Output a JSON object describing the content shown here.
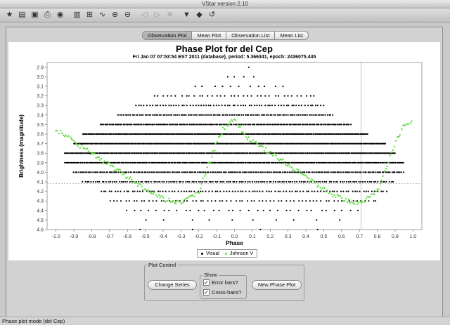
{
  "window": {
    "title": "VStar version 2.10"
  },
  "toolbar": {
    "icons": [
      {
        "name": "new-star-icon",
        "glyph": "★"
      },
      {
        "name": "open-file-icon",
        "glyph": "▤"
      },
      {
        "name": "save-icon",
        "glyph": "▣"
      },
      {
        "name": "print-icon",
        "glyph": "⎙"
      },
      {
        "name": "info-icon",
        "glyph": "◉"
      },
      {
        "name": "properties-icon",
        "glyph": "▥"
      },
      {
        "name": "raw-data-icon",
        "glyph": "⊞"
      },
      {
        "name": "phase-plot-icon",
        "glyph": "∿"
      },
      {
        "name": "zoom-in-icon",
        "glyph": "⊕"
      },
      {
        "name": "zoom-out-icon",
        "glyph": "⊖"
      },
      {
        "name": "pan-left-icon",
        "glyph": "◁"
      },
      {
        "name": "pan-right-icon",
        "glyph": "▷"
      },
      {
        "name": "close-icon",
        "glyph": "✕"
      },
      {
        "name": "filter-icon",
        "glyph": "▼"
      },
      {
        "name": "select-icon",
        "glyph": "◆"
      },
      {
        "name": "undo-icon",
        "glyph": "↺"
      }
    ]
  },
  "tabs": [
    "Observation Plot",
    "Mean Plot",
    "Observation List",
    "Mean List"
  ],
  "active_tab": 0,
  "colors": {
    "visual": "#000000",
    "johnson_v": "#5ddc3c",
    "crosshair": "#999999"
  },
  "chart_data": {
    "type": "scatter",
    "title": "Phase Plot for del Cep",
    "subtitle": "Fri Jan 07 07:53:54 EST 2011 (database), period: 5.366341, epoch: 2436075.445",
    "xlabel": "Phase",
    "ylabel": "Brightness (magnitude)",
    "xlim": [
      -1.05,
      1.05
    ],
    "ylim": [
      4.6,
      2.85
    ],
    "xticks": [
      "-1.0",
      "-0.9",
      "-0.8",
      "-0.7",
      "-0.6",
      "-0.5",
      "-0.4",
      "-0.3",
      "-0.2",
      "-0.1",
      "0.0",
      "0.1",
      "0.2",
      "0.3",
      "0.4",
      "0.5",
      "0.6",
      "0.7",
      "0.8",
      "0.9",
      "1.0"
    ],
    "yticks": [
      "2.9",
      "3.0",
      "3.1",
      "3.2",
      "3.3",
      "3.4",
      "3.5",
      "3.6",
      "3.7",
      "3.8",
      "3.9",
      "4.0",
      "4.1",
      "4.2",
      "4.3",
      "4.4",
      "4.5",
      "4.6"
    ],
    "crosshair": {
      "x": 0.71,
      "y": 4.12
    },
    "series": [
      {
        "name": "Visual",
        "rows": [
          {
            "mag": 2.9,
            "min": 0.08,
            "max": 0.1,
            "step": 0.03
          },
          {
            "mag": 3.0,
            "min": -0.04,
            "max": 0.15,
            "step": 0.05
          },
          {
            "mag": 3.1,
            "min": -0.22,
            "max": 0.3,
            "step": 0.05
          },
          {
            "mag": 3.2,
            "min": -0.45,
            "max": 0.45,
            "step": 0.025
          },
          {
            "mag": 3.3,
            "min": -0.55,
            "max": 0.5,
            "step": 0.015
          },
          {
            "mag": 3.4,
            "min": -0.65,
            "max": 0.55,
            "step": 0.01
          },
          {
            "mag": 3.5,
            "min": -0.75,
            "max": 0.65,
            "step": 0.008
          },
          {
            "mag": 3.6,
            "min": -0.85,
            "max": 0.75,
            "step": 0.006
          },
          {
            "mag": 3.7,
            "min": -0.9,
            "max": 0.85,
            "step": 0.006
          },
          {
            "mag": 3.8,
            "min": -0.95,
            "max": 0.9,
            "step": 0.006
          },
          {
            "mag": 3.9,
            "min": -0.95,
            "max": 0.95,
            "step": 0.007
          },
          {
            "mag": 4.0,
            "min": -0.9,
            "max": 0.95,
            "step": 0.009
          },
          {
            "mag": 4.1,
            "min": -0.85,
            "max": 0.9,
            "step": 0.012
          },
          {
            "mag": 4.2,
            "min": -0.75,
            "max": 0.85,
            "step": 0.016
          },
          {
            "mag": 4.3,
            "min": -0.7,
            "max": 0.8,
            "step": 0.022
          },
          {
            "mag": 4.4,
            "min": -0.6,
            "max": 0.7,
            "step": 0.04
          },
          {
            "mag": 4.5,
            "min": -0.5,
            "max": 0.6,
            "step": 0.12
          },
          {
            "mag": 4.6,
            "min": -0.45,
            "max": 0.55,
            "step": 0.28
          }
        ]
      },
      {
        "name": "Johnson V",
        "curve": [
          {
            "phase": -1.0,
            "mag": 3.55
          },
          {
            "phase": -0.9,
            "mag": 3.68
          },
          {
            "phase": -0.8,
            "mag": 3.8
          },
          {
            "phase": -0.7,
            "mag": 3.92
          },
          {
            "phase": -0.6,
            "mag": 4.05
          },
          {
            "phase": -0.5,
            "mag": 4.18
          },
          {
            "phase": -0.4,
            "mag": 4.28
          },
          {
            "phase": -0.3,
            "mag": 4.33
          },
          {
            "phase": -0.2,
            "mag": 4.2
          },
          {
            "phase": -0.15,
            "mag": 3.95
          },
          {
            "phase": -0.1,
            "mag": 3.7
          },
          {
            "phase": -0.05,
            "mag": 3.5
          },
          {
            "phase": 0.0,
            "mag": 3.45
          },
          {
            "phase": 0.05,
            "mag": 3.6
          },
          {
            "phase": 0.1,
            "mag": 3.68
          },
          {
            "phase": 0.2,
            "mag": 3.8
          },
          {
            "phase": 0.3,
            "mag": 3.92
          },
          {
            "phase": 0.4,
            "mag": 4.05
          },
          {
            "phase": 0.5,
            "mag": 4.18
          },
          {
            "phase": 0.6,
            "mag": 4.28
          },
          {
            "phase": 0.7,
            "mag": 4.33
          },
          {
            "phase": 0.8,
            "mag": 4.2
          },
          {
            "phase": 0.85,
            "mag": 3.95
          },
          {
            "phase": 0.9,
            "mag": 3.7
          },
          {
            "phase": 0.95,
            "mag": 3.5
          },
          {
            "phase": 1.0,
            "mag": 3.45
          }
        ]
      }
    ],
    "legend": [
      "Visual",
      "Johnson V"
    ],
    "legend_position": "bottom-center",
    "grid": false
  },
  "plot_control": {
    "title": "Plot Control",
    "show_label": "Show",
    "change_series_label": "Change Series",
    "error_bars_label": "Error bars?",
    "error_bars_checked": true,
    "crosshairs_label": "Cross-hairs?",
    "crosshairs_checked": true,
    "new_phase_plot_label": "New Phase Plot"
  },
  "status": {
    "text": "Phase plot mode (del Cep)"
  }
}
